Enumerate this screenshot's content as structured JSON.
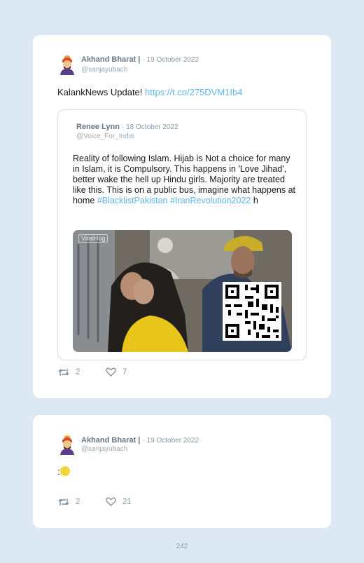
{
  "posts": [
    {
      "author": "Akhand Bharat |",
      "date": "· 19 October 2022",
      "handle": "@sanjayubach",
      "text": "KalankNews Update! ",
      "link": "https://t.co/275DVM1Ib4",
      "quote": {
        "author": "Renee Lynn",
        "date": "· 18 October 2022",
        "handle": "@Voice_For_India",
        "text": "Reality of following Islam. Hijab is Not a choice for many in Islam, it is Compulsory. This happens in 'Love Jihad', better wake the hell up Hindu girls. Majority are treated like this. This is on a public bus, imagine what happens at home ",
        "hashtag1": "#BlacklistPakistan",
        "hashtag2": "#IranRevolution2022",
        "text_end": " h",
        "watermark": "ViralHog"
      },
      "retweets": "2",
      "likes": "7"
    },
    {
      "author": "Akhand Bharat |",
      "date": "· 19 October 2022",
      "handle": "@sanjayubach",
      "text": ":",
      "emoji": "😃",
      "retweets": "2",
      "likes": "21"
    }
  ],
  "page_number": "242",
  "colors": {
    "background": "#dce8f3",
    "link": "#5eb5e8",
    "muted": "#8899a6"
  }
}
